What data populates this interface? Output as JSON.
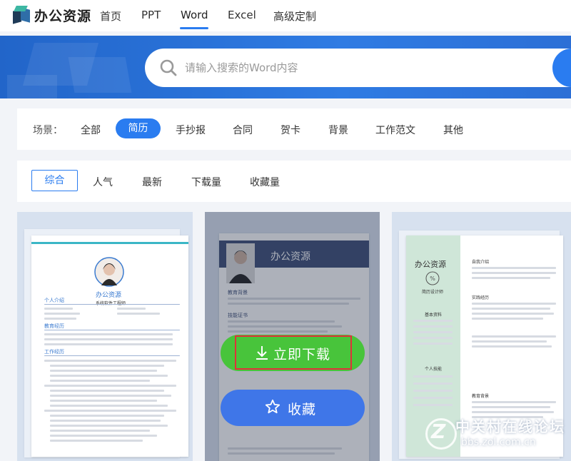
{
  "header": {
    "logo_text": "办公资源",
    "nav": [
      "首页",
      "PPT",
      "Word",
      "Excel",
      "高级定制"
    ],
    "active_nav": "Word"
  },
  "search": {
    "placeholder": "请输入搜索的Word内容"
  },
  "scene_filter": {
    "label": "场景：",
    "items": [
      "全部",
      "简历",
      "手抄报",
      "合同",
      "贺卡",
      "背景",
      "工作范文",
      "其他"
    ],
    "selected": "简历"
  },
  "sort_filter": {
    "items": [
      "综合",
      "人气",
      "最新",
      "下载量",
      "收藏量"
    ],
    "selected": "综合"
  },
  "cards": [
    {
      "name": "办公资源",
      "role": "系统软件工程师",
      "sections": [
        "个人介绍",
        "教育经历",
        "工作经历"
      ]
    },
    {
      "name": "办公资源",
      "sections": [
        "教育背景",
        "技能证书"
      ],
      "download_label": "立即下载",
      "favorite_label": "收藏"
    },
    {
      "name": "办公资源",
      "role": "简历设计师",
      "sections": [
        "自我介绍",
        "实践经历",
        "教育背景",
        "基本资料",
        "个人技能"
      ]
    }
  ],
  "watermark": {
    "title": "中关村在线论坛",
    "url": "bbs.zol.com.cn"
  },
  "colors": {
    "accent": "#2a7cf0",
    "download": "#48c43b",
    "favorite": "#3f76e8",
    "highlight_outline": "#e0303a"
  }
}
